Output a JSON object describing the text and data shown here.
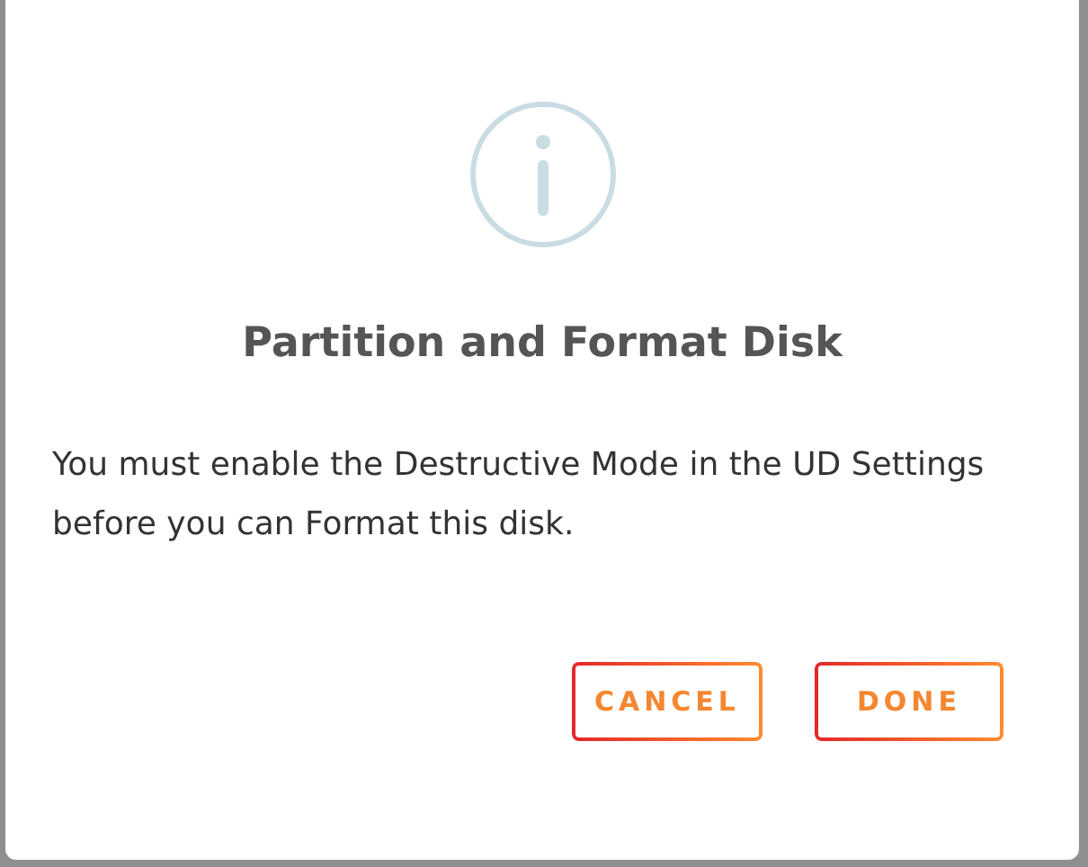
{
  "dialog": {
    "title": "Partition and Format Disk",
    "message": "You must enable the Destructive Mode in the UD Settings before you can Format this disk.",
    "buttons": [
      {
        "label": "CANCEL"
      },
      {
        "label": "DONE"
      }
    ]
  }
}
